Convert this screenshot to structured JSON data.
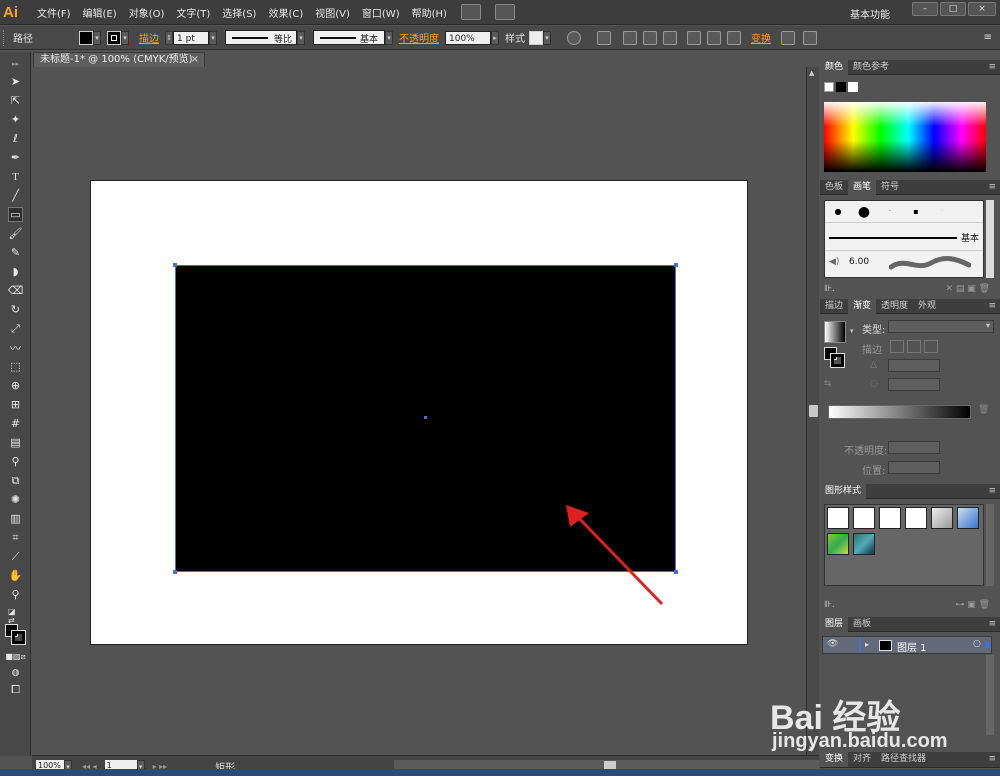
{
  "app": {
    "logo": "Ai",
    "workspace": "基本功能",
    "menu": [
      "文件(F)",
      "编辑(E)",
      "对象(O)",
      "文字(T)",
      "选择(S)",
      "效果(C)",
      "视图(V)",
      "窗口(W)",
      "帮助(H)"
    ]
  },
  "control_bar": {
    "object_type": "路径",
    "stroke_label": "描边",
    "stroke_weight": "1 pt",
    "stroke_profile": "等比",
    "brush": "基本",
    "opacity_label": "不透明度",
    "opacity_value": "100%",
    "style_label": "样式",
    "transform_label": "变换"
  },
  "document": {
    "tab_title": "未标题-1* @ 100% (CMYK/预览)",
    "tab_close": "×"
  },
  "status_bar": {
    "zoom": "100%",
    "artboard_number": "1",
    "selection_info": "矩形"
  },
  "panels": {
    "color": {
      "tabs": [
        "颜色",
        "颜色参考"
      ]
    },
    "brushes": {
      "tabs": [
        "色板",
        "画笔",
        "符号"
      ],
      "basic_label": "基本",
      "brush_size": "6.00"
    },
    "gradient": {
      "tabs": [
        "描边",
        "渐变",
        "透明度",
        "外观"
      ],
      "type_label": "类型:",
      "stroke_label": "描边",
      "opacity_label": "不透明度:",
      "position_label": "位置:"
    },
    "graphic_styles": {
      "tabs": [
        "图形样式"
      ]
    },
    "layers": {
      "tabs": [
        "图层",
        "画板"
      ],
      "layer_name": "图层 1"
    },
    "bottom_tabs": [
      "变换",
      "对齐",
      "路径查找器"
    ]
  },
  "watermark": {
    "logo": "Bai 经验",
    "url": "jingyan.baidu.com"
  },
  "colors": {
    "accent": "#f0a030",
    "selection": "#4a6fd4",
    "arrow": "#e02020"
  }
}
